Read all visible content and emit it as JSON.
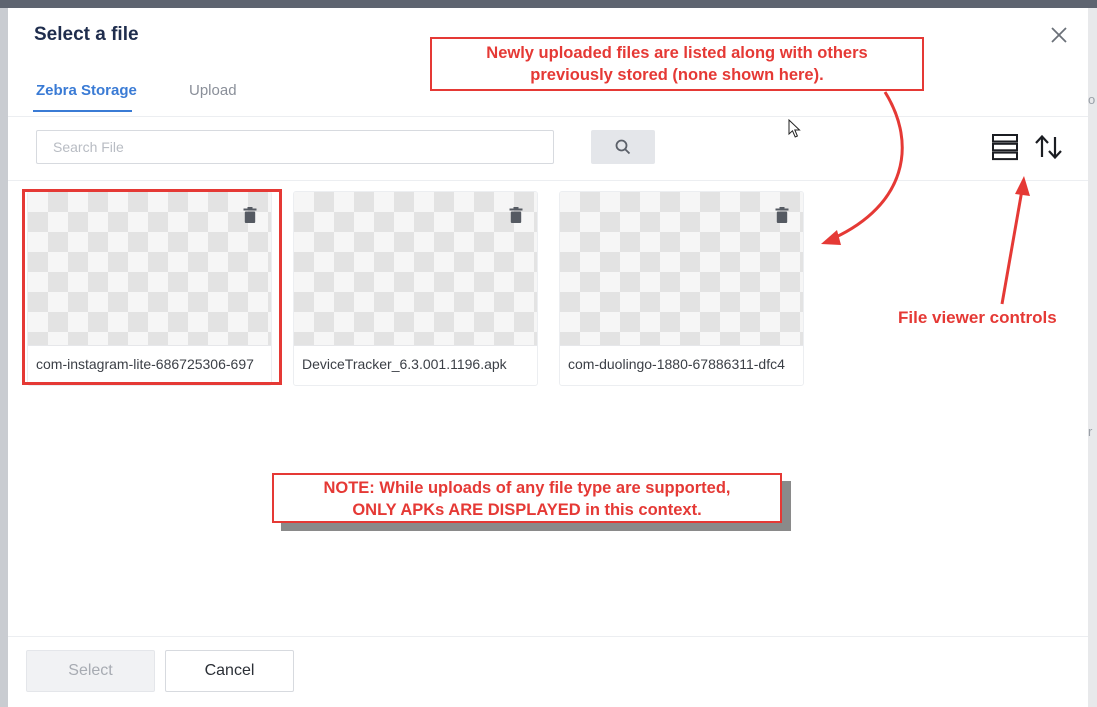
{
  "dialog": {
    "title": "Select a file",
    "close_icon": "close-icon"
  },
  "tabs": [
    {
      "label": "Zebra Storage",
      "active": true
    },
    {
      "label": "Upload",
      "active": false
    }
  ],
  "search": {
    "placeholder": "Search File",
    "value": "",
    "button_icon": "search-icon"
  },
  "view_controls": {
    "list_view_icon": "list-view-icon",
    "sort_icon": "sort-icon"
  },
  "files": [
    {
      "name": "com-instagram-lite-686725306-697",
      "selected": true
    },
    {
      "name": "DeviceTracker_6.3.001.1196.apk",
      "selected": false
    },
    {
      "name": "com-duolingo-1880-67886311-dfc4",
      "selected": false
    }
  ],
  "footer": {
    "select_label": "Select",
    "cancel_label": "Cancel"
  },
  "annotations": {
    "top_callout": {
      "line1": "Newly uploaded files are listed along with others",
      "line2": "previously stored (none shown here)."
    },
    "controls_label": "File viewer controls",
    "note_callout": {
      "line1": "NOTE: While uploads of any file type are supported,",
      "line2": "ONLY APKs ARE DISPLAYED in this context."
    },
    "color": "#e53935"
  },
  "colors": {
    "accent": "#3a7bd5",
    "title": "#1f2d4d"
  }
}
